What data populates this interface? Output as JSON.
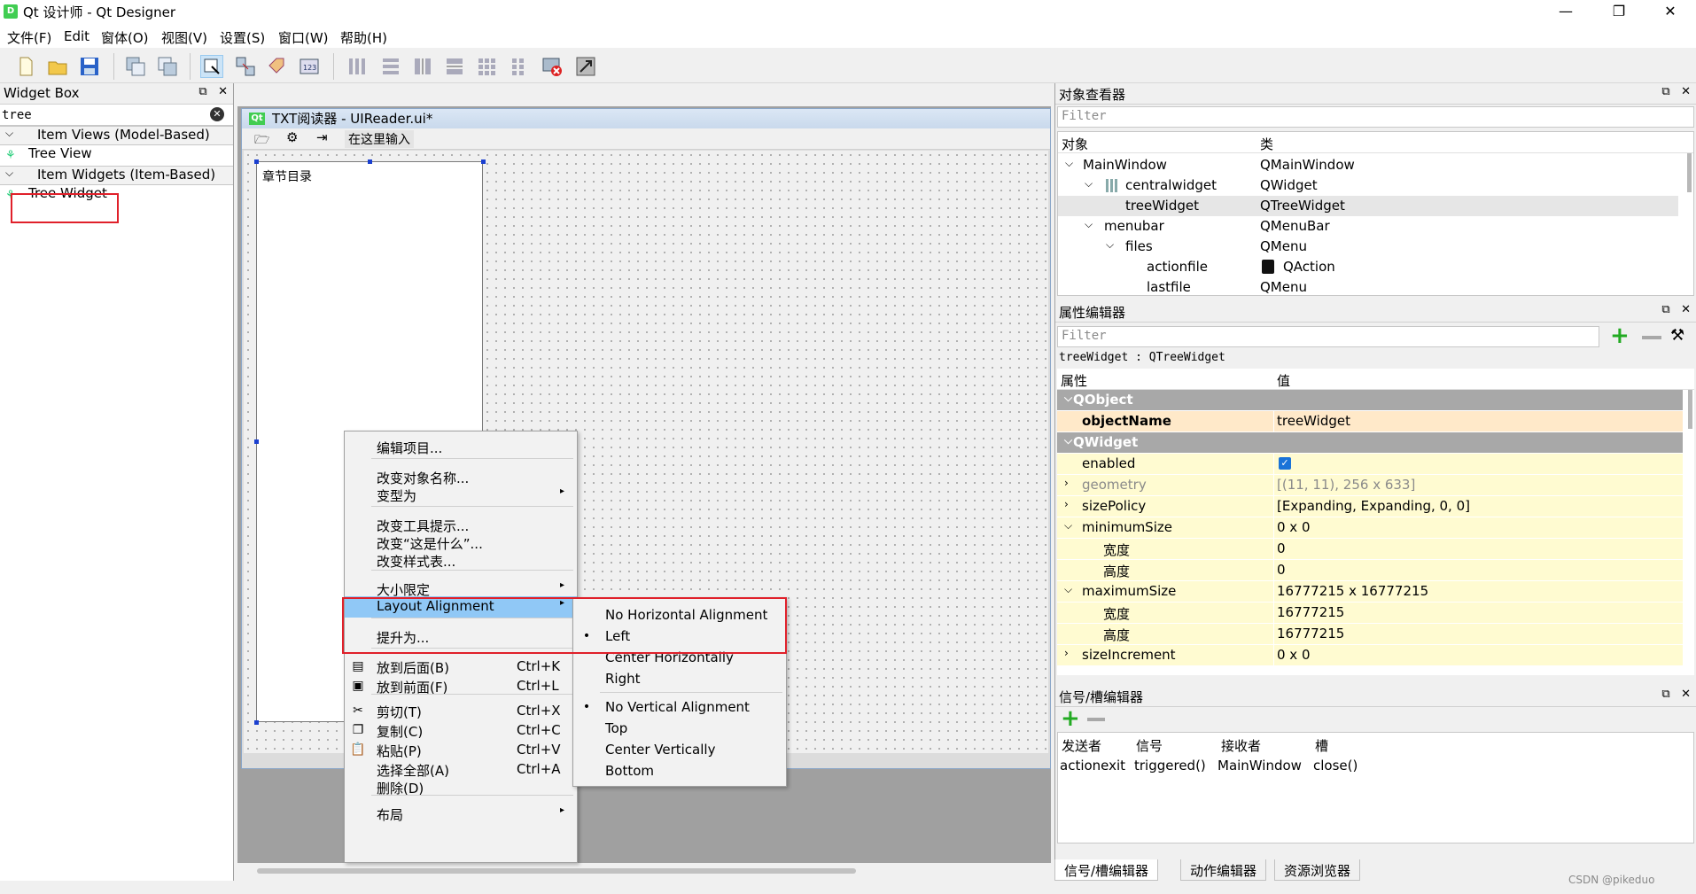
{
  "window": {
    "title": "Qt 设计师 - Qt Designer",
    "app_icon": "D",
    "controls": [
      "—",
      "❐",
      "✕"
    ]
  },
  "menubar": [
    "文件(F)",
    "Edit",
    "窗体(O)",
    "视图(V)",
    "设置(S)",
    "窗口(W)",
    "帮助(H)"
  ],
  "widget_box": {
    "title": "Widget Box",
    "search_value": "tree",
    "categories": [
      {
        "label": "Item Views (Model-Based)",
        "items": [
          "Tree View"
        ]
      },
      {
        "label": "Item Widgets (Item-Based)",
        "items": [
          "Tree Widget"
        ]
      }
    ]
  },
  "form": {
    "title": "TXT阅读器 - UIReader.ui*",
    "qt_badge": "Qt",
    "menubar_placeholder": "在这里输入",
    "tree_header": "章节目录"
  },
  "context_menu": {
    "items": [
      {
        "label": "编辑项目..."
      },
      {
        "label": "改变对象名称..."
      },
      {
        "label": "变型为",
        "submenu": true
      },
      {
        "label": "改变工具提示..."
      },
      {
        "label": "改变“这是什么”..."
      },
      {
        "label": "改变样式表..."
      },
      {
        "label": "大小限定",
        "submenu": true
      },
      {
        "label": "Layout Alignment",
        "submenu": true,
        "highlighted": true
      },
      {
        "label": "提升为..."
      },
      {
        "label": "放到后面(B)",
        "shortcut": "Ctrl+K"
      },
      {
        "label": "放到前面(F)",
        "shortcut": "Ctrl+L"
      },
      {
        "label": "剪切(T)",
        "shortcut": "Ctrl+X"
      },
      {
        "label": "复制(C)",
        "shortcut": "Ctrl+C"
      },
      {
        "label": "粘贴(P)",
        "shortcut": "Ctrl+V"
      },
      {
        "label": "选择全部(A)",
        "shortcut": "Ctrl+A"
      },
      {
        "label": "删除(D)"
      },
      {
        "label": "布局",
        "submenu": true
      }
    ]
  },
  "alignment_submenu": {
    "items": [
      {
        "label": "No Horizontal Alignment",
        "checked": false
      },
      {
        "label": "Left",
        "checked": true
      },
      {
        "label": "Center Horizontally",
        "checked": false
      },
      {
        "label": "Right",
        "checked": false
      },
      {
        "label": "No Vertical Alignment",
        "checked": true
      },
      {
        "label": "Top",
        "checked": false
      },
      {
        "label": "Center Vertically",
        "checked": false
      },
      {
        "label": "Bottom",
        "checked": false
      }
    ]
  },
  "object_inspector": {
    "title": "对象查看器",
    "filter_placeholder": "Filter",
    "col_object": "对象",
    "col_class": "类",
    "rows": [
      {
        "object": "MainWindow",
        "class": "QMainWindow"
      },
      {
        "object": "centralwidget",
        "class": "QWidget"
      },
      {
        "object": "treeWidget",
        "class": "QTreeWidget"
      },
      {
        "object": "menubar",
        "class": "QMenuBar"
      },
      {
        "object": "files",
        "class": "QMenu"
      },
      {
        "object": "actionfile",
        "class": "QAction"
      },
      {
        "object": "lastfile",
        "class": "QMenu"
      }
    ]
  },
  "property_editor": {
    "title": "属性编辑器",
    "filter_placeholder": "Filter",
    "object_label": "treeWidget : QTreeWidget",
    "col_property": "属性",
    "col_value": "值",
    "rows": [
      {
        "name": "QObject",
        "value": "",
        "type": "group"
      },
      {
        "name": "objectName",
        "value": "treeWidget",
        "type": "bold"
      },
      {
        "name": "QWidget",
        "value": "",
        "type": "group"
      },
      {
        "name": "enabled",
        "value": "",
        "type": "check"
      },
      {
        "name": "geometry",
        "value": "[(11, 11), 256 x 633]",
        "type": "dim"
      },
      {
        "name": "sizePolicy",
        "value": "[Expanding, Expanding, 0, 0]",
        "type": "normal"
      },
      {
        "name": "minimumSize",
        "value": "0 x 0",
        "type": "expanded"
      },
      {
        "name": "宽度",
        "value": "0",
        "type": "child"
      },
      {
        "name": "高度",
        "value": "0",
        "type": "child"
      },
      {
        "name": "maximumSize",
        "value": "16777215 x 16777215",
        "type": "expanded"
      },
      {
        "name": "宽度",
        "value": "16777215",
        "type": "child"
      },
      {
        "name": "高度",
        "value": "16777215",
        "type": "child"
      },
      {
        "name": "sizeIncrement",
        "value": "0 x 0",
        "type": "normal"
      }
    ]
  },
  "signal_slot_editor": {
    "title": "信号/槽编辑器",
    "columns": [
      "发送者",
      "信号",
      "接收者",
      "槽"
    ],
    "rows": [
      {
        "sender": "actionexit",
        "signal": "triggered()",
        "receiver": "MainWindow",
        "slot": "close()"
      }
    ]
  },
  "bottom_tabs": [
    "信号/槽编辑器",
    "动作编辑器",
    "资源浏览器"
  ],
  "watermark": "CSDN @pikeduo",
  "colors": {
    "highlight": "#90c8f6",
    "annotation_red": "#e0202a",
    "group_header": "#a8a8a8",
    "property_yellow": "#fffbd1"
  }
}
